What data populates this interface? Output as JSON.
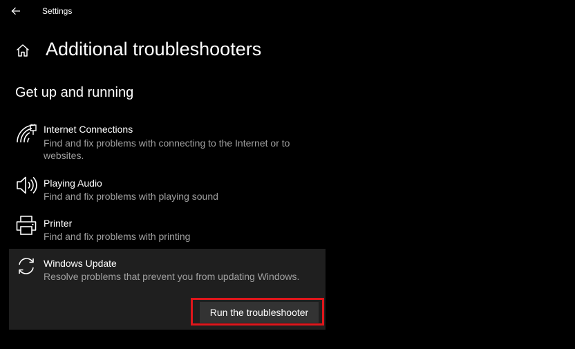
{
  "window": {
    "app_title": "Settings"
  },
  "page": {
    "title": "Additional troubleshooters",
    "section_title": "Get up and running"
  },
  "items": [
    {
      "name": "Internet Connections",
      "description": "Find and fix problems with connecting to the Internet or to websites.",
      "icon": "wifi-network-icon"
    },
    {
      "name": "Playing Audio",
      "description": "Find and fix problems with playing sound",
      "icon": "speaker-icon"
    },
    {
      "name": "Printer",
      "description": "Find and fix problems with printing",
      "icon": "printer-icon"
    },
    {
      "name": "Windows Update",
      "description": "Resolve problems that prevent you from updating Windows.",
      "icon": "refresh-icon",
      "selected": true,
      "action_label": "Run the troubleshooter"
    }
  ],
  "colors": {
    "background": "#000000",
    "selected_background": "#1f1f1f",
    "button_background": "#333333",
    "secondary_text": "#a0a0a0",
    "highlight_border": "#e0161b"
  }
}
